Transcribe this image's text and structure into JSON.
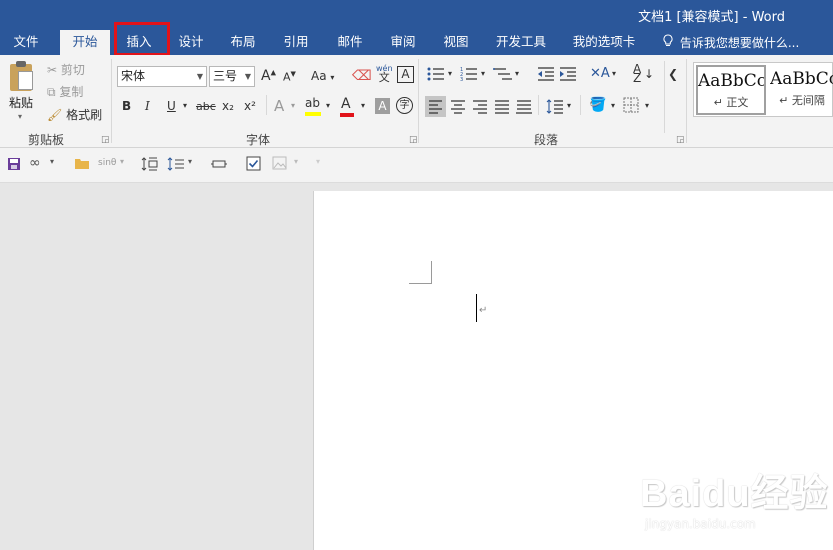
{
  "window": {
    "title": "文档1 [兼容模式] - Word"
  },
  "tabs": [
    {
      "label": "文件"
    },
    {
      "label": "开始"
    },
    {
      "label": "插入"
    },
    {
      "label": "设计"
    },
    {
      "label": "布局"
    },
    {
      "label": "引用"
    },
    {
      "label": "邮件"
    },
    {
      "label": "审阅"
    },
    {
      "label": "视图"
    },
    {
      "label": "开发工具"
    },
    {
      "label": "我的选项卡"
    }
  ],
  "active_tab": "开始",
  "highlighted_tab": "插入",
  "tell_me": {
    "placeholder": "告诉我您想要做什么...",
    "icon": "lightbulb-icon"
  },
  "clipboard": {
    "label": "剪贴板",
    "paste": "粘贴",
    "cut": "剪切",
    "copy": "复制",
    "format_painter": "格式刷"
  },
  "font": {
    "label": "字体",
    "font_name": "宋体",
    "font_size": "三号",
    "grow": "A",
    "shrink": "A",
    "change_case": "Aa",
    "phonetic_top": "wén",
    "phonetic_bottom": "文",
    "border_char": "A",
    "bold": "B",
    "italic": "I",
    "underline": "U",
    "strike": "abc",
    "subscript": "x₂",
    "superscript": "x²",
    "effects": "A",
    "highlight": "ab",
    "font_color": "A",
    "shading_char": "A",
    "enclose_char": "字"
  },
  "paragraph": {
    "label": "段落"
  },
  "styles": {
    "items": [
      {
        "sample": "AaBbCcDd",
        "name": "↵ 正文"
      },
      {
        "sample": "AaBbCcDd",
        "name": "↵ 无间隔"
      }
    ]
  },
  "qat": {
    "formula_label": "sinθ"
  },
  "document": {
    "paragraph_mark": "↵"
  },
  "watermark": {
    "logo": "Baidu经验",
    "url": "jingyan.baidu.com"
  },
  "colors": {
    "title_bar": "#2b579a",
    "ribbon": "#f3f3f3",
    "highlight_box": "#e1131a",
    "font_color_bar": "#e1131a",
    "highlight_bar": "#ffff00"
  }
}
